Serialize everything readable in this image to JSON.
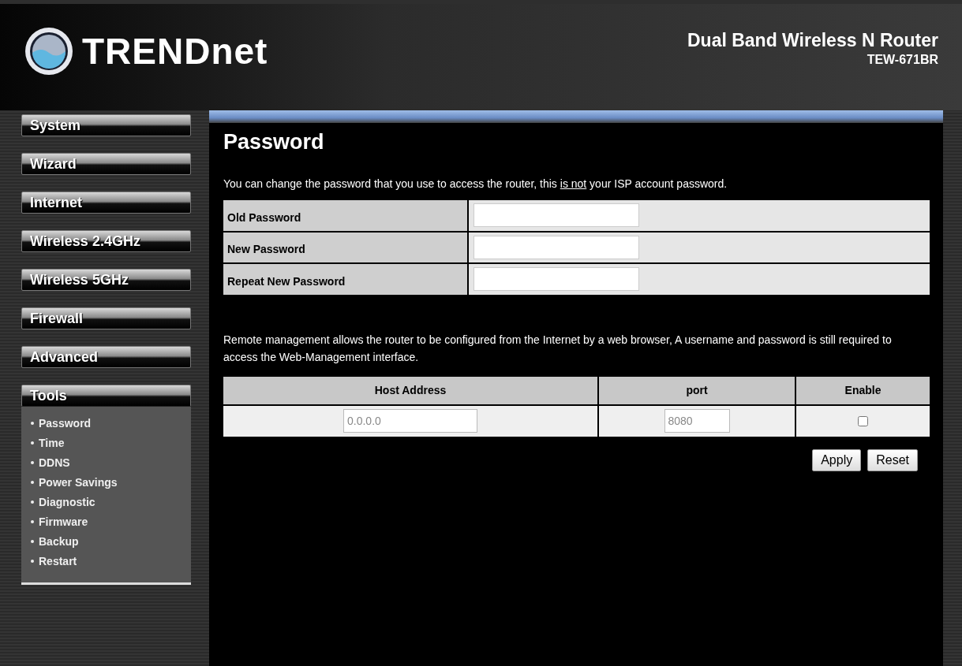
{
  "header": {
    "logo_text": "TRENDnet",
    "product_name": "Dual Band Wireless N Router",
    "model": "TEW-671BR"
  },
  "sidebar": {
    "items": [
      {
        "label": "System",
        "expanded": false
      },
      {
        "label": "Wizard",
        "expanded": false
      },
      {
        "label": "Internet",
        "expanded": false
      },
      {
        "label": "Wireless 2.4GHz",
        "expanded": false
      },
      {
        "label": "Wireless 5GHz",
        "expanded": false
      },
      {
        "label": "Firewall",
        "expanded": false
      },
      {
        "label": "Advanced",
        "expanded": false
      },
      {
        "label": "Tools",
        "expanded": true,
        "children": [
          "Password",
          "Time",
          "DDNS",
          "Power Savings",
          "Diagnostic",
          "Firmware",
          "Backup",
          "Restart"
        ]
      }
    ]
  },
  "content": {
    "title": "Password",
    "intro": {
      "before": "You can change the password that you use to access the router, this ",
      "underlined": "is not",
      "after": " your ISP account password."
    },
    "password_fields": [
      {
        "label": "Old Password"
      },
      {
        "label": "New Password"
      },
      {
        "label": "Repeat New Password"
      }
    ],
    "remote_text": "Remote management allows the router to be configured from the Internet by a web browser, A username and password is still required to access the Web-Management interface.",
    "remote_table": {
      "columns": [
        "Host Address",
        "port",
        "Enable"
      ],
      "row": {
        "host_address": "0.0.0.0",
        "port": "8080",
        "enable_checked": false
      }
    },
    "buttons": [
      "Apply",
      "Reset"
    ]
  }
}
